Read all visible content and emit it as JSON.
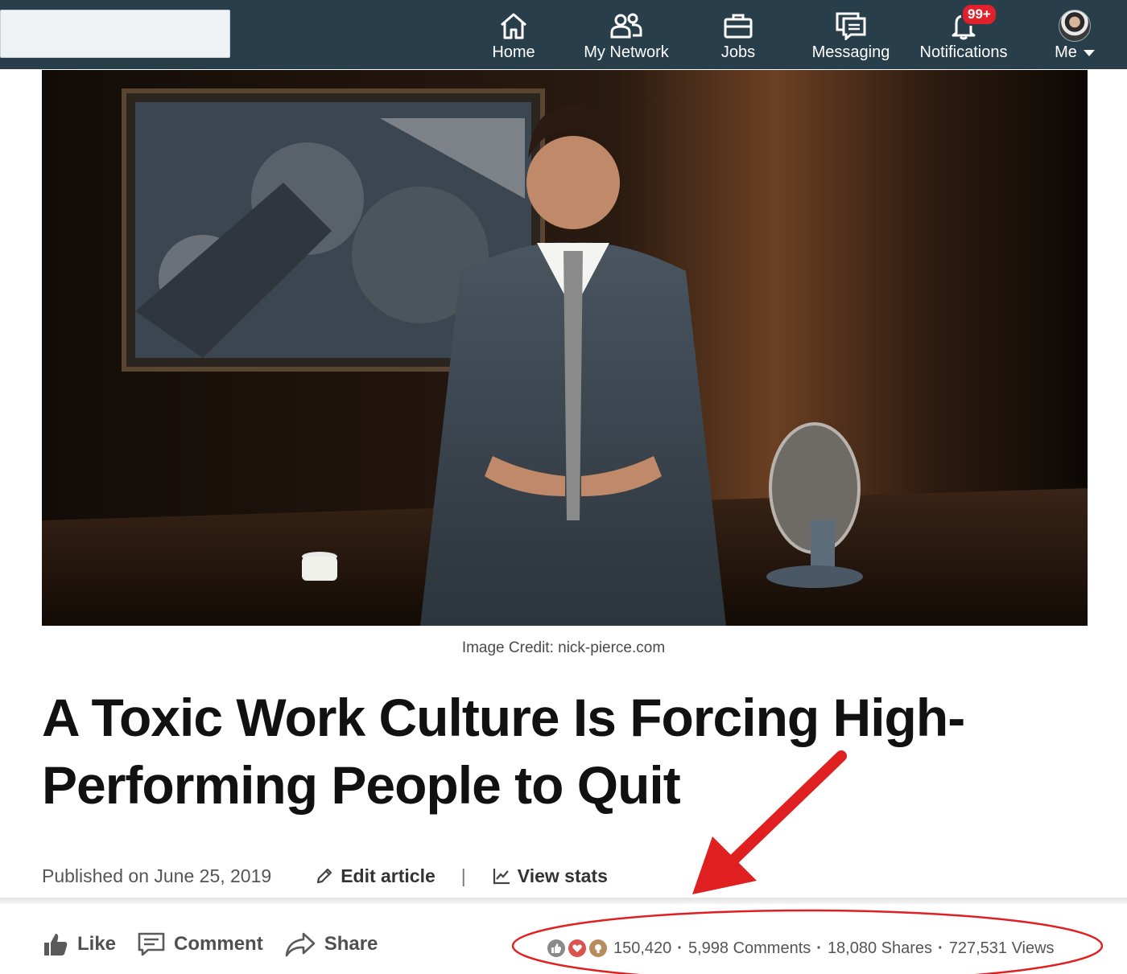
{
  "nav": {
    "items": [
      {
        "label": "Home",
        "icon": "home-icon"
      },
      {
        "label": "My Network",
        "icon": "network-icon"
      },
      {
        "label": "Jobs",
        "icon": "briefcase-icon"
      },
      {
        "label": "Messaging",
        "icon": "messaging-icon"
      },
      {
        "label": "Notifications",
        "icon": "bell-icon",
        "badge": "99+"
      },
      {
        "label": "Me",
        "icon": "avatar"
      }
    ]
  },
  "article": {
    "image_caption": "Image Credit: nick-pierce.com",
    "title": "A Toxic Work Culture Is Forcing High-Performing People to Quit",
    "published": "Published on June 25, 2019",
    "edit_label": "Edit article",
    "stats_label": "View stats"
  },
  "social": {
    "like_label": "Like",
    "comment_label": "Comment",
    "share_label": "Share",
    "reactions": "150,420",
    "comments": "5,998 Comments",
    "shares": "18,080 Shares",
    "views": "727,531 Views",
    "reaction_icons": [
      "like-reaction-icon",
      "love-reaction-icon",
      "insightful-reaction-icon"
    ]
  },
  "colors": {
    "nav_bg": "#283e4a",
    "badge": "#e0212b",
    "annotation": "#e02020"
  }
}
